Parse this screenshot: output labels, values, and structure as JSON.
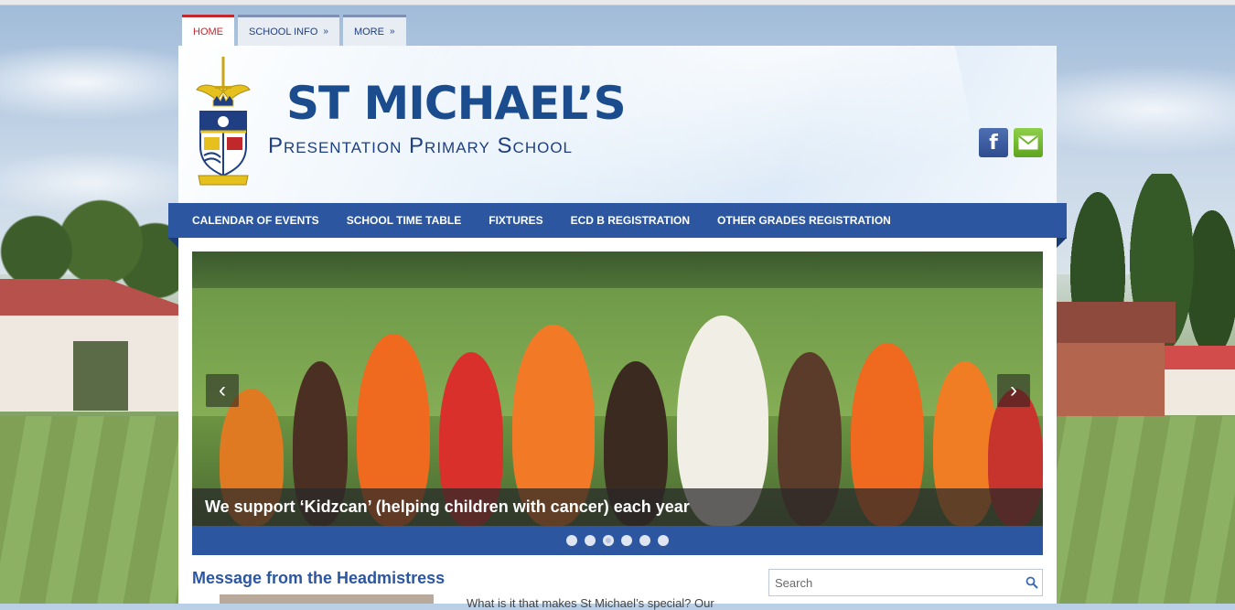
{
  "top_tabs": [
    {
      "label": "HOME",
      "chevron": ""
    },
    {
      "label": "SCHOOL INFO",
      "chevron": "»"
    },
    {
      "label": "MORE",
      "chevron": "»"
    }
  ],
  "header": {
    "title": "ST MICHAEL’S",
    "subtitle": "Presentation Primary School",
    "social": [
      {
        "icon": "facebook-icon",
        "glyph": "f",
        "color": "#3b5998"
      },
      {
        "icon": "mail-icon",
        "color": "#6fb42b"
      }
    ]
  },
  "main_nav": [
    "CALENDAR OF EVENTS",
    "SCHOOL TIME TABLE",
    "FIXTURES",
    "ECD B REGISTRATION",
    "OTHER GRADES REGISTRATION"
  ],
  "slider": {
    "caption": "We support ‘Kidzcan’ (helping children with cancer) each year",
    "prev_glyph": "‹",
    "next_glyph": "›",
    "slide_count": 6,
    "active_index": 2
  },
  "message": {
    "title": "Message from the Headmistress",
    "text": "What is it that makes St Michael’s special? Our"
  },
  "search": {
    "placeholder": "Search"
  },
  "colors": {
    "brand_blue": "#2c57a0",
    "active_tab_red": "#c0282b",
    "title_blue": "#1a4c8e"
  }
}
